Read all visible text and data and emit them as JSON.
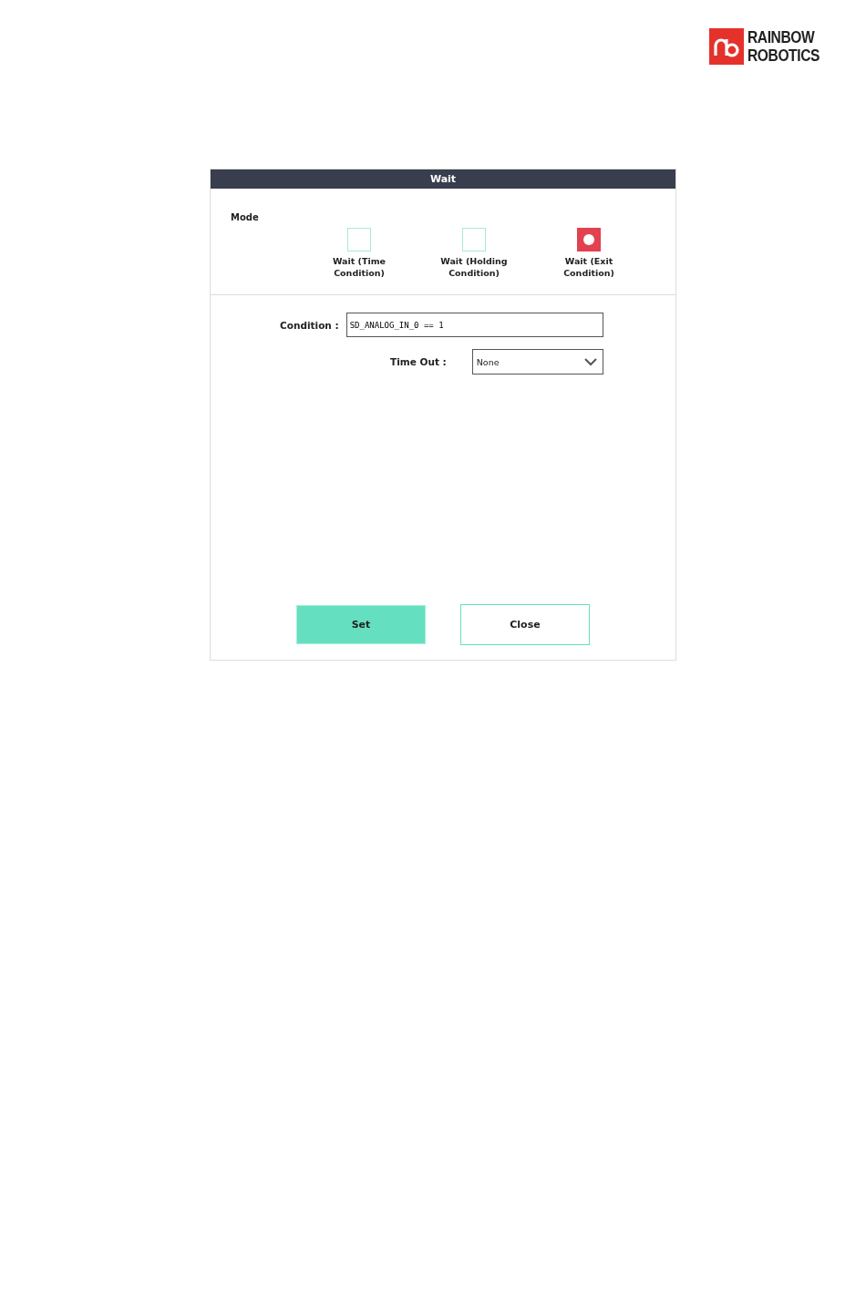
{
  "logo": {
    "line_1": "RAINBOW",
    "line_2": "ROBOTICS"
  },
  "dialog": {
    "title": "Wait",
    "mode_label": "Mode",
    "modes": [
      {
        "label": "Wait (Time Condition)",
        "selected": false
      },
      {
        "label": "Wait (Holding Condition)",
        "selected": false
      },
      {
        "label": "Wait (Exit Condition)",
        "selected": true
      }
    ],
    "condition": {
      "label": "Condition :",
      "value": "SD_ANALOG_IN_0 == 1"
    },
    "time_out": {
      "label": "Time Out :",
      "value": "None"
    },
    "buttons": [
      {
        "label": "Set",
        "kind": "primary"
      },
      {
        "label": "Close",
        "kind": "secondary"
      }
    ]
  }
}
